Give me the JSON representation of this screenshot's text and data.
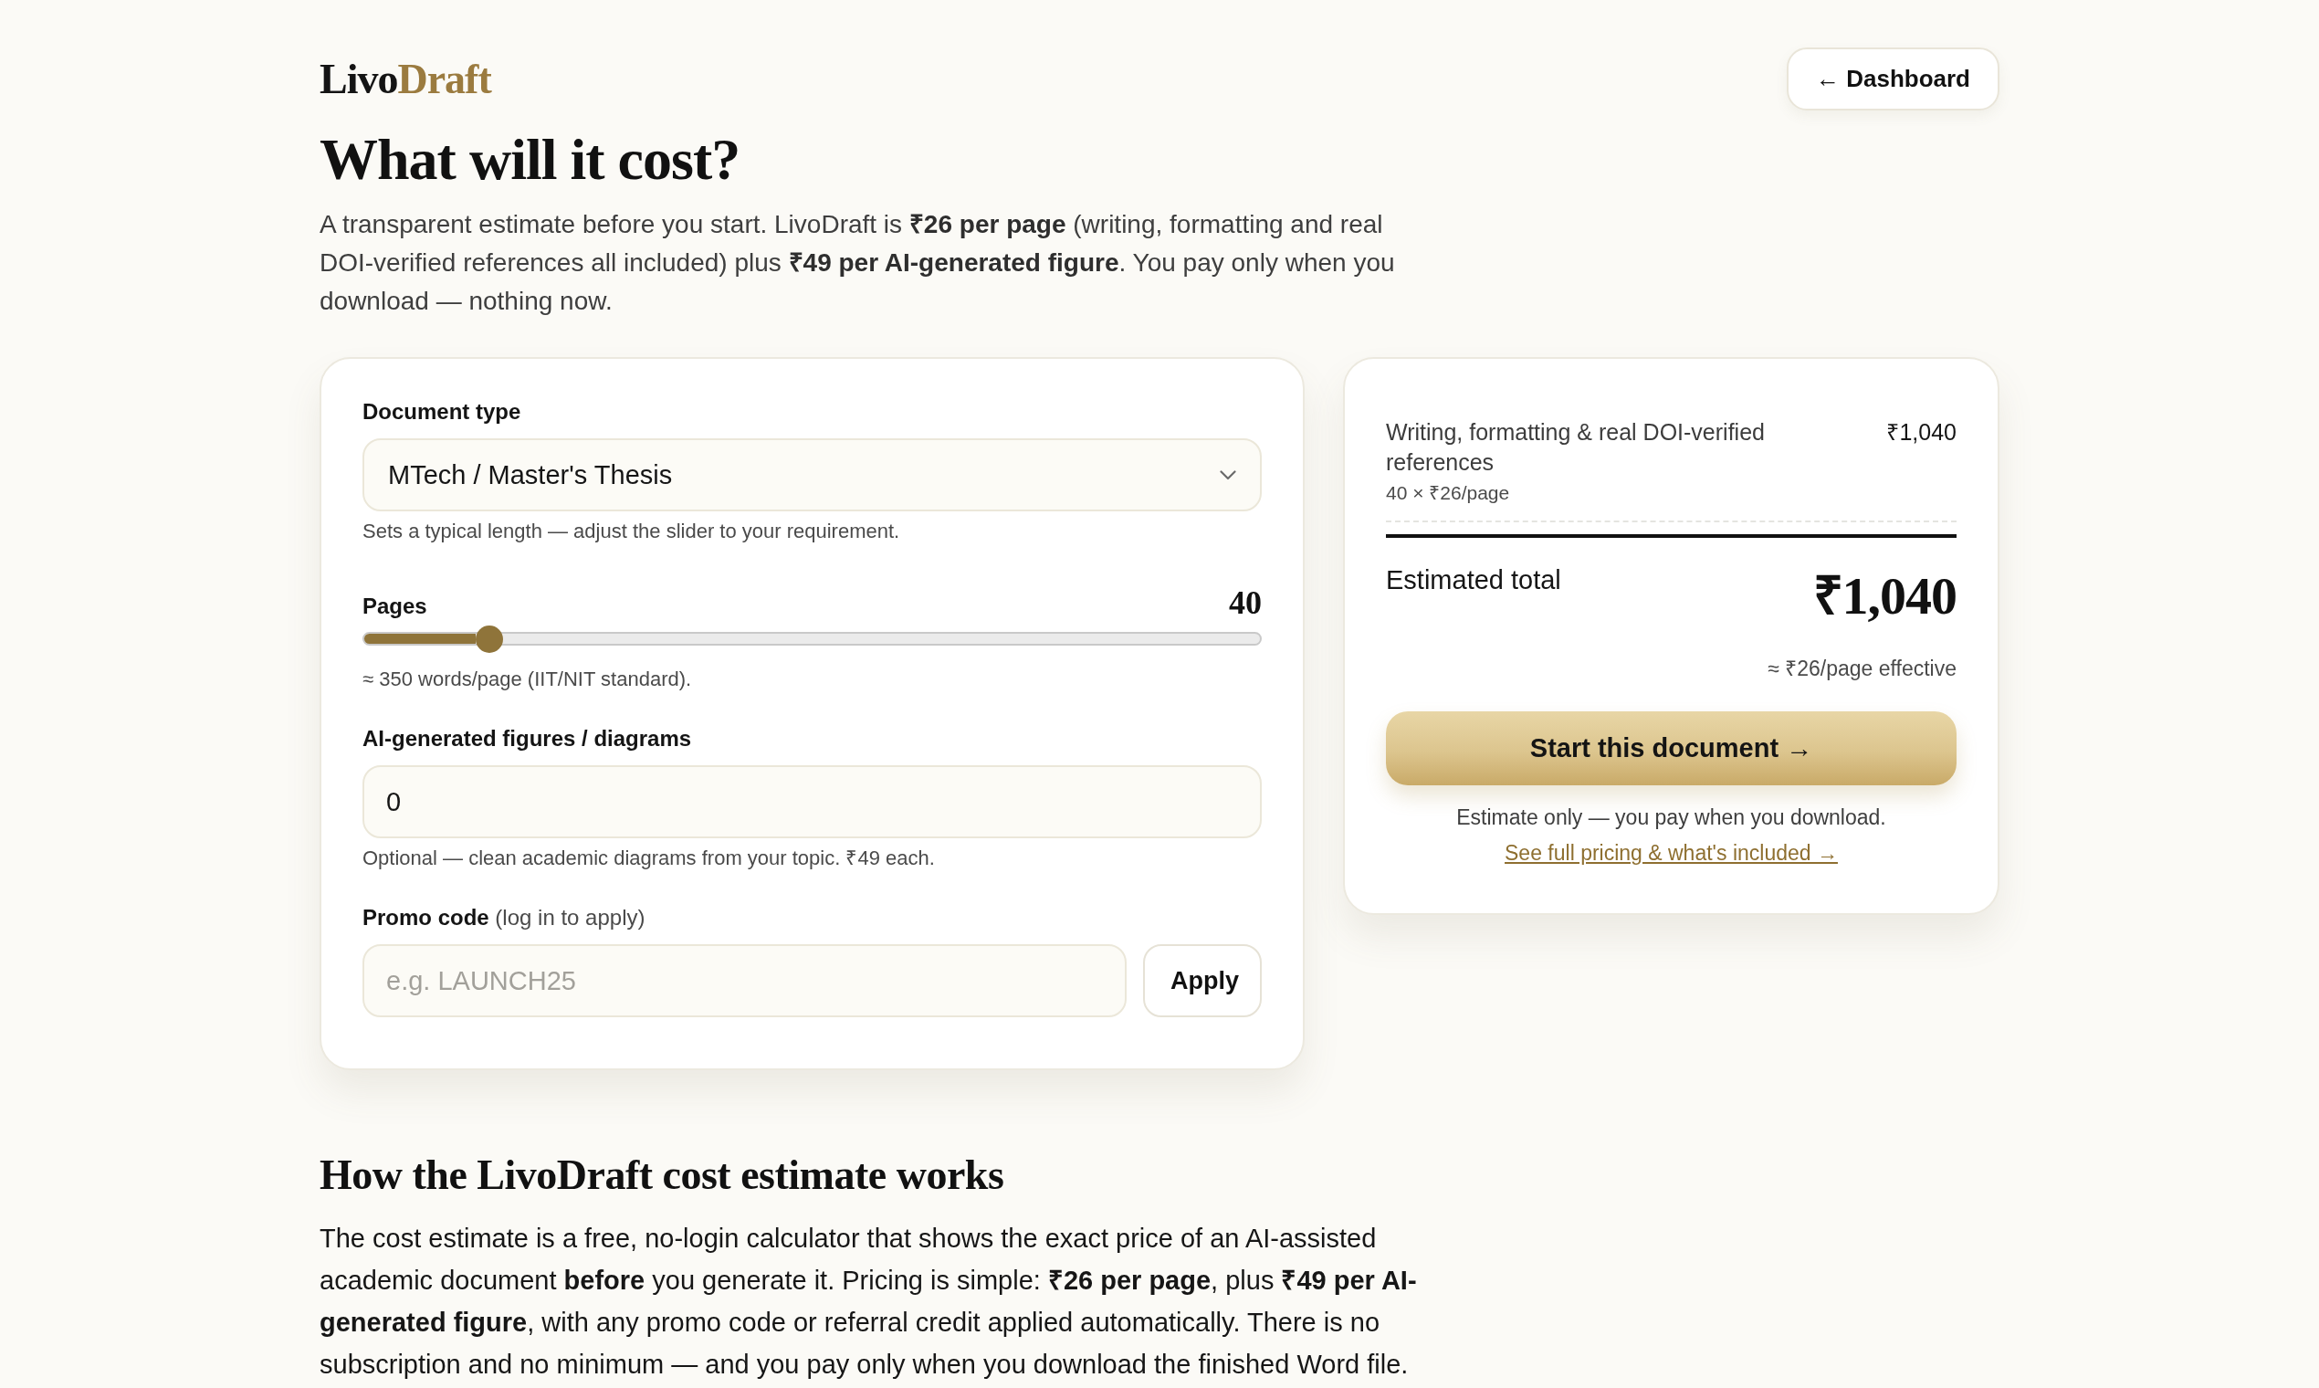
{
  "header": {
    "logo": {
      "text": "Livo",
      "accent": "Draft"
    },
    "dashboard_button": "← Dashboard"
  },
  "hero": {
    "title": "What will it cost?",
    "intro": "A transparent estimate before you start. LivoDraft is **₹26 per page** (writing, formatting and real DOI-verified references all included) plus **₹49 per AI-generated figure**. You pay only when you download — nothing now."
  },
  "calculator": {
    "document_type": {
      "label": "Document type",
      "value": "MTech / Master's Thesis",
      "hint": "Sets a typical length — adjust the slider to your requirement."
    },
    "pages": {
      "label": "Pages",
      "reading": "40",
      "level": 0.14,
      "hint": "≈ 350 words/page (IIT/NIT standard)."
    },
    "figures": {
      "label": "AI-generated figures / diagrams",
      "value": "0",
      "hint": "Optional — clean academic diagrams from your topic. ₹49 each."
    },
    "promo": {
      "label": "**Promo code** (log in to apply)",
      "placeholder": "e.g. LAUNCH25",
      "button": "Apply"
    }
  },
  "summary": {
    "line_items": [
      {
        "label": "Writing, formatting & real DOI-verified references",
        "detail": "40 × ₹26/page",
        "amount": "₹1,040"
      }
    ],
    "total_label": "Estimated total",
    "total": "₹1,040",
    "effective": "≈ ₹26/page effective",
    "cta": "Start this document →",
    "note": "Estimate only — you pay when you download.",
    "link": "See full pricing & what's included →"
  },
  "explainer": {
    "heading": "How the LivoDraft cost estimate works",
    "body": "The cost estimate is a free, no-login calculator that shows the exact price of an AI-assisted academic document **before** you generate it. Pricing is simple: **₹26 per page**, plus **₹49 per AI-generated figure**, with any promo code or referral credit applied automatically. There is no subscription and no minimum — and you pay only when you download the finished Word file."
  }
}
